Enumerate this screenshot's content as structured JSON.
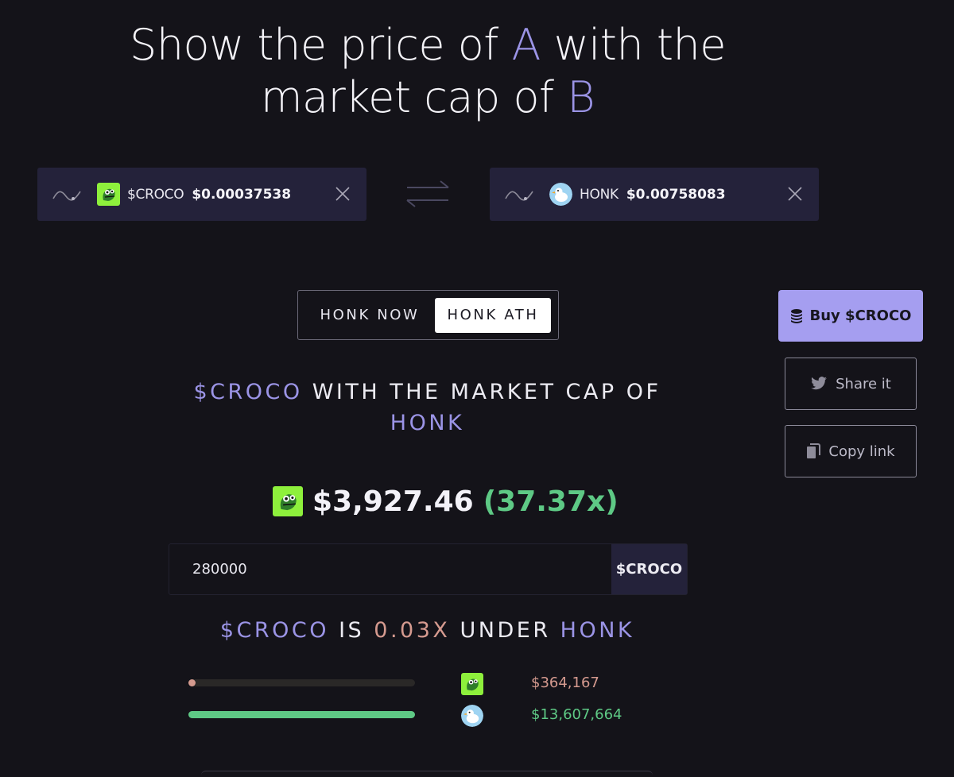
{
  "headline": {
    "part1": "Show the price of ",
    "token_a": "A",
    "part2": " with the",
    "part3": "market cap of ",
    "token_b": "B"
  },
  "token_a": {
    "symbol": "$CROCO",
    "price": "$0.00037538",
    "icon": "croco-avatar"
  },
  "token_b": {
    "symbol": "HONK",
    "price": "$0.00758083",
    "icon": "honk-avatar"
  },
  "toggle": {
    "now_label": "HONK NOW",
    "ath_label": "HONK ATH",
    "selected": "ath"
  },
  "actions": {
    "buy_label": "Buy $CROCO",
    "share_label": "Share it",
    "copy_label": "Copy link"
  },
  "comparison": {
    "token_a": "$CROCO",
    "middle": " WITH THE MARKET CAP OF ",
    "token_b": "HONK"
  },
  "result": {
    "price": "$3,927.46",
    "multiplier": "(37.37x)"
  },
  "amount": {
    "value": "280000",
    "unit": "$CROCO"
  },
  "under": {
    "token_a": "$CROCO",
    "is": " IS ",
    "factor": "0.03X",
    "under": " UNDER ",
    "token_b": "HONK"
  },
  "market_caps": [
    {
      "token": "$CROCO",
      "value": "$364,167",
      "fraction": 0.027,
      "color": "#d59a8f"
    },
    {
      "token": "HONK",
      "value": "$13,607,664",
      "fraction": 1.0,
      "color": "#5ec985"
    }
  ],
  "colors": {
    "accent": "#9b94e6",
    "buy": "#a59ef0",
    "positive": "#5ec985",
    "negative": "#d59a8f",
    "background": "#141319"
  }
}
